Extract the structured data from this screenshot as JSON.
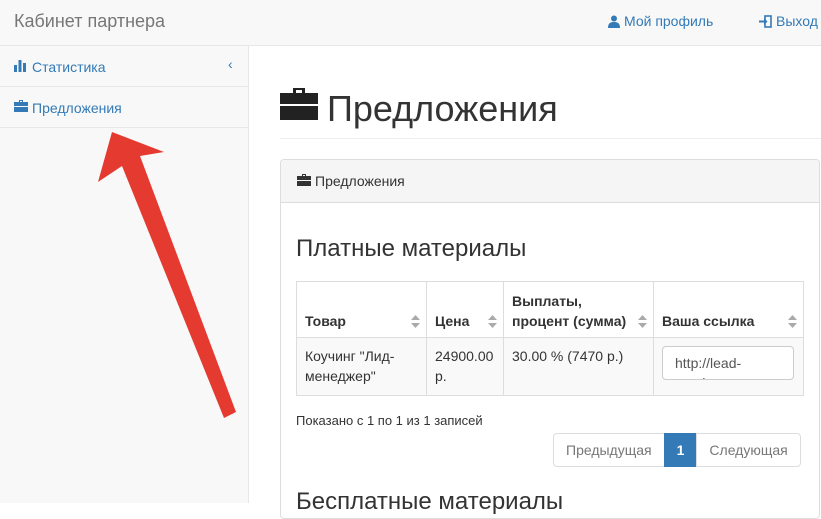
{
  "navbar": {
    "brand": "Кабинет партнера",
    "profile_label": "Мой профиль",
    "logout_label": "Выход"
  },
  "sidebar": {
    "items": [
      {
        "label": "Статистика",
        "icon": "bar-chart-icon"
      },
      {
        "label": "Предложения",
        "icon": "briefcase-icon"
      }
    ]
  },
  "page": {
    "title": "Предложения",
    "panel_heading": "Предложения",
    "section_title": "Платные материалы",
    "section_title_2": "Бесплатные материалы"
  },
  "table": {
    "columns": [
      "Товар",
      "Цена",
      "Выплаты, процент (сумма)",
      "Ваша ссылка"
    ],
    "rows": [
      {
        "product": "Коучинг \"Лид-менеджер\"",
        "price": "24900.00 р.",
        "payout": "30.00 % (7470 р.)",
        "link": "http://lead-academy"
      }
    ],
    "info": "Показано с 1 по 1 из 1 записей"
  },
  "pagination": {
    "prev_label": "Предыдущая",
    "current_page": "1",
    "next_label": "Следующая"
  },
  "colors": {
    "link": "#337ab7",
    "arrow": "#e53a2f",
    "navbar_bg": "#f8f8f8"
  }
}
